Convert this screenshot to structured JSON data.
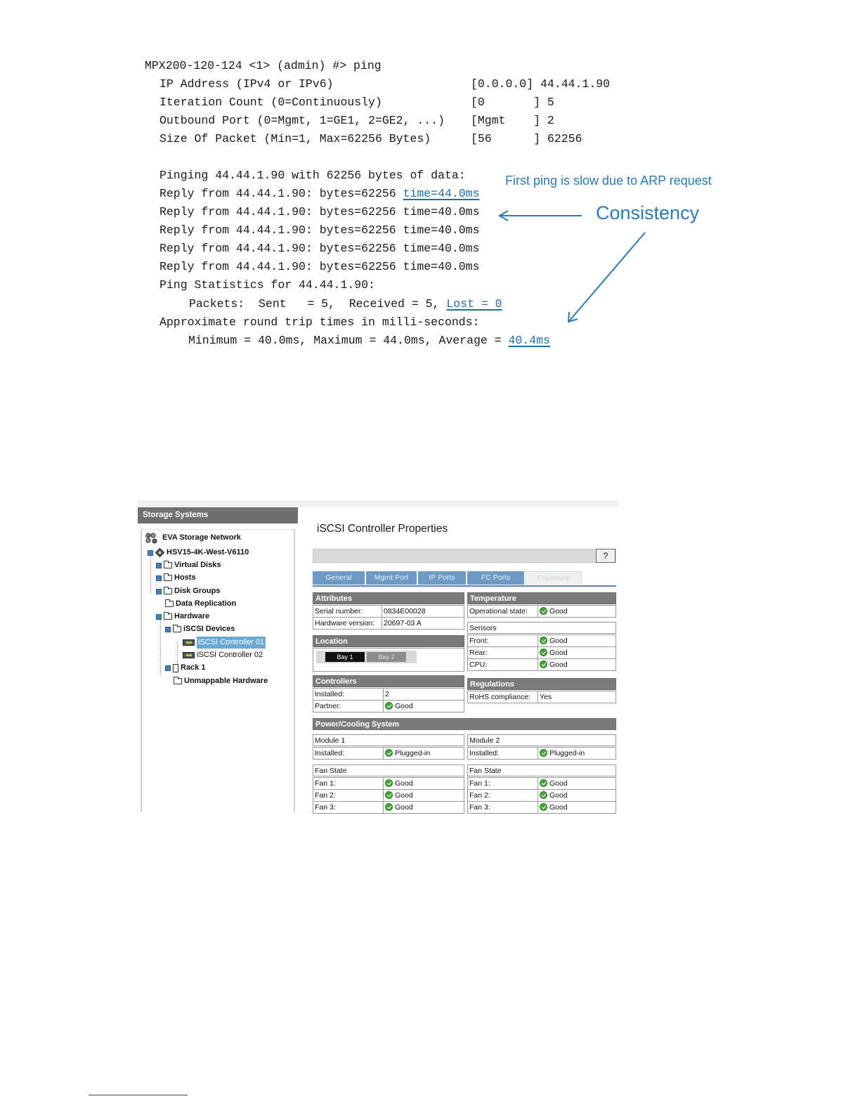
{
  "terminal": {
    "prompt": "MPX200-120-124 <1> (admin) #> ping",
    "params": [
      {
        "label": "IP Address (IPv4 or IPv6)",
        "value": "[0.0.0.0] 44.44.1.90"
      },
      {
        "label": "Iteration Count (0=Continuously)",
        "value": "[0       ] 5"
      },
      {
        "label": "Outbound Port (0=Mgmt, 1=GE1, 2=GE2, ...)",
        "value": "[Mgmt    ] 2"
      },
      {
        "label": "Size Of Packet (Min=1, Max=62256 Bytes)",
        "value": "[56      ] 62256"
      }
    ],
    "pinging": "Pinging 44.44.1.90 with 62256 bytes of data:",
    "reply_prefix": "Reply from 44.44.1.90: bytes=62256 ",
    "reply_times": [
      "time=44.0ms",
      "time=40.0ms",
      "time=40.0ms",
      "time=40.0ms",
      "time=40.0ms"
    ],
    "stats_header": "Ping Statistics for 44.44.1.90:",
    "packets_prefix": "Packets:  Sent   = 5,  Received = 5, ",
    "packets_lost": "Lost = 0",
    "rtt_header": "Approximate round trip times in milli-seconds:",
    "rtt_prefix": "Minimum = 40.0ms, Maximum = 44.0ms, Average = ",
    "rtt_average": "40.4ms"
  },
  "annotations": {
    "first_ping": "First ping is slow due to ARP request",
    "consistency": "Consistency",
    "color": "#2a7ab5"
  },
  "sidebar": {
    "title": "Storage Systems",
    "tree": [
      {
        "label": "EVA Storage Network",
        "icon": "network-icon",
        "bold": true
      },
      {
        "label": "HSV15-4K-West-V6110",
        "icon": "storage-system-icon",
        "bold": true
      },
      {
        "label": "Virtual Disks",
        "icon": "folder-icon",
        "bold": true
      },
      {
        "label": "Hosts",
        "icon": "folder-icon",
        "bold": true
      },
      {
        "label": "Disk Groups",
        "icon": "folder-icon",
        "bold": true
      },
      {
        "label": "Data Replication",
        "icon": "folder-icon",
        "bold": true
      },
      {
        "label": "Hardware",
        "icon": "folder-icon",
        "bold": true
      },
      {
        "label": "iSCSI Devices",
        "icon": "folder-icon",
        "bold": true
      },
      {
        "label": "iSCSI Controller 01",
        "icon": "controller-icon",
        "bold": false,
        "selected": true
      },
      {
        "label": "iSCSI Controller 02",
        "icon": "controller-icon",
        "bold": false
      },
      {
        "label": "Rack 1",
        "icon": "rack-icon",
        "bold": true
      },
      {
        "label": "Unmappable Hardware",
        "icon": "folder-icon",
        "bold": true
      }
    ]
  },
  "panel": {
    "title": "iSCSI Controller Properties",
    "help": "?",
    "tabs": [
      "General",
      "Mgmt Port",
      "IP Ports",
      "FC Ports",
      "Enclosure"
    ],
    "active_tab": "Enclosure",
    "attributes": {
      "title": "Attributes",
      "rows": [
        {
          "label": "Serial number:",
          "value": "0834E00028"
        },
        {
          "label": "Hardware version:",
          "value": "20697-03 A"
        }
      ]
    },
    "temperature": {
      "title": "Temperature",
      "operational_label": "Operational state:",
      "operational_value": "Good",
      "sensors_title": "Sensors",
      "sensors": [
        {
          "label": "Front:",
          "value": "Good"
        },
        {
          "label": "Rear:",
          "value": "Good"
        },
        {
          "label": "CPU:",
          "value": "Good"
        }
      ]
    },
    "location": {
      "title": "Location",
      "bays": [
        "Bay 1",
        "Bay 2"
      ]
    },
    "controllers": {
      "title": "Controllers",
      "rows": [
        {
          "label": "Installed:",
          "value": "2",
          "ok": false
        },
        {
          "label": "Partner:",
          "value": "Good",
          "ok": true
        }
      ]
    },
    "regulations": {
      "title": "Regulations",
      "rows": [
        {
          "label": "RoHS compliance:",
          "value": "Yes"
        }
      ]
    },
    "power": {
      "title": "Power/Cooling System",
      "modules": [
        {
          "name": "Module 1",
          "installed_label": "Installed:",
          "installed_value": "Plugged-in",
          "fan_title": "Fan State",
          "fans": [
            {
              "label": "Fan 1:",
              "value": "Good"
            },
            {
              "label": "Fan 2:",
              "value": "Good"
            },
            {
              "label": "Fan 3:",
              "value": "Good"
            }
          ]
        },
        {
          "name": "Module 2",
          "installed_label": "Installed:",
          "installed_value": "Plugged-in",
          "fan_title": "Fan State",
          "fans": [
            {
              "label": "Fan 1:",
              "value": "Good"
            },
            {
              "label": "Fan 2:",
              "value": "Good"
            },
            {
              "label": "Fan 3:",
              "value": "Good"
            }
          ]
        }
      ]
    }
  }
}
